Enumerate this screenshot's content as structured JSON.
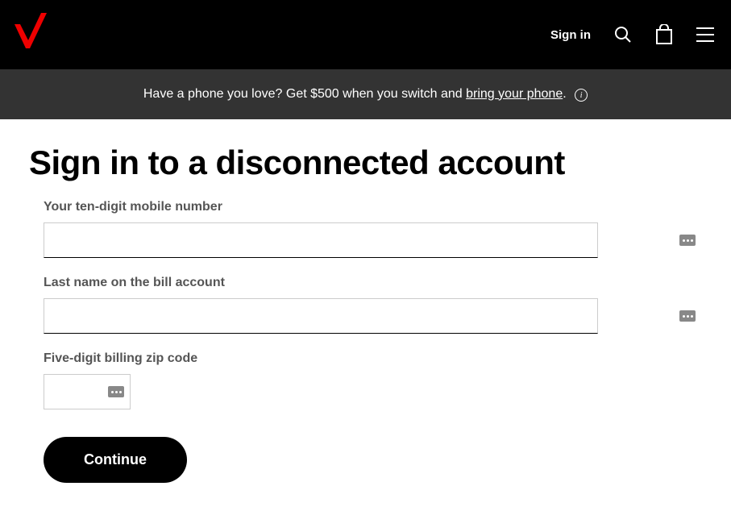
{
  "header": {
    "sign_in": "Sign in"
  },
  "promo": {
    "prefix": "Have a phone you love? Get $500 when you switch and ",
    "link": "bring your phone",
    "suffix": "."
  },
  "page": {
    "title": "Sign in to a disconnected account"
  },
  "form": {
    "mobile_label": "Your ten-digit mobile number",
    "mobile_value": "",
    "lastname_label": "Last name on the bill account",
    "lastname_value": "",
    "zip_label": "Five-digit billing zip code",
    "zip_value": "",
    "continue": "Continue"
  }
}
